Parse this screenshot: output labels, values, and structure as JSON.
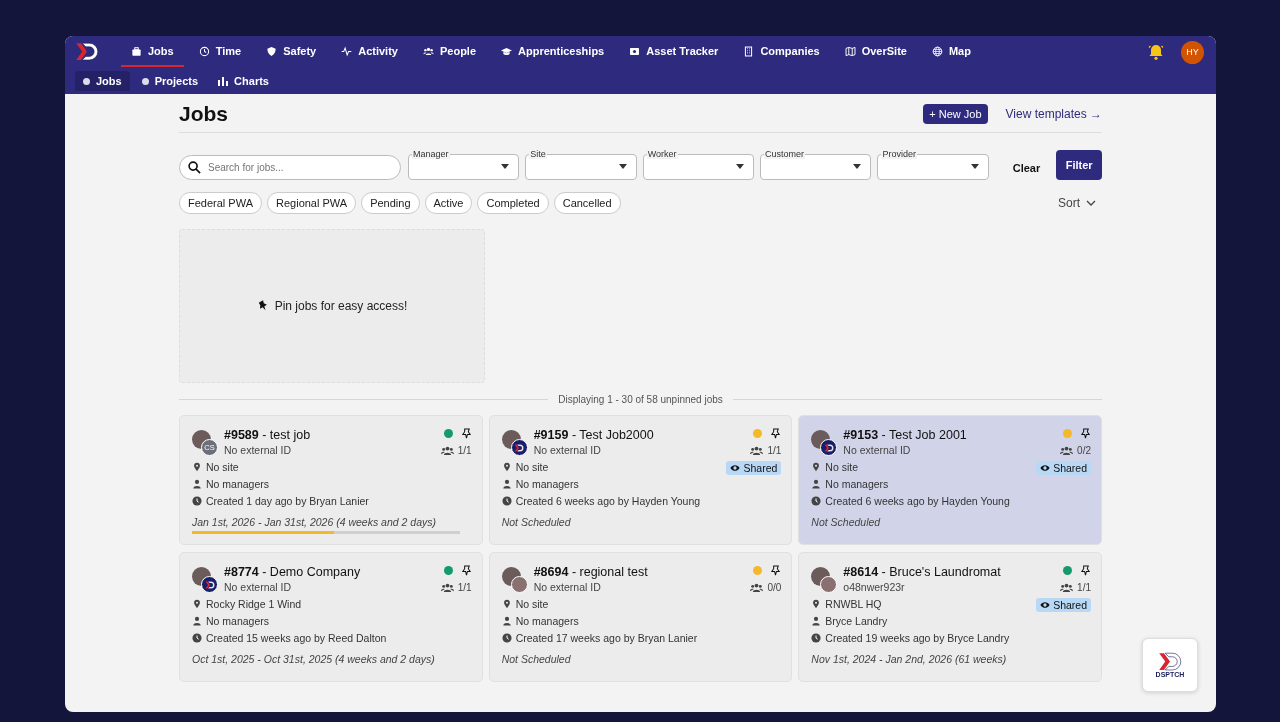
{
  "nav": {
    "items": [
      {
        "label": "Jobs",
        "selected": true
      },
      {
        "label": "Time",
        "selected": false
      },
      {
        "label": "Safety",
        "selected": false
      },
      {
        "label": "Activity",
        "selected": false
      },
      {
        "label": "People",
        "selected": false
      },
      {
        "label": "Apprenticeships",
        "selected": false
      },
      {
        "label": "Asset Tracker",
        "selected": false
      },
      {
        "label": "Companies",
        "selected": false
      },
      {
        "label": "OverSite",
        "selected": false
      },
      {
        "label": "Map",
        "selected": false
      }
    ],
    "user_initials": "HY"
  },
  "subnav": [
    {
      "label": "Jobs",
      "kind": "dot",
      "selected": true
    },
    {
      "label": "Projects",
      "kind": "dot",
      "selected": false
    },
    {
      "label": "Charts",
      "kind": "chart",
      "selected": false
    }
  ],
  "header": {
    "title": "Jobs",
    "new_job": "+ New Job",
    "view_templates": "View templates →"
  },
  "search": {
    "placeholder": "Search for jobs..."
  },
  "filters": [
    {
      "label": "Manager"
    },
    {
      "label": "Site"
    },
    {
      "label": "Worker"
    },
    {
      "label": "Customer"
    },
    {
      "label": "Provider"
    }
  ],
  "clear": "Clear",
  "filter": "Filter",
  "chips": [
    "Federal PWA",
    "Regional PWA",
    "Pending",
    "Active",
    "Completed",
    "Cancelled"
  ],
  "sort": "Sort",
  "pin_area": "Pin jobs for easy access!",
  "summary": "Displaying 1 - 30 of 58 unpinned jobs",
  "jobs": [
    {
      "title": "**#9589** - test job",
      "external_id": "No external ID",
      "kind": "initials",
      "avatar_initials": "CS",
      "color": "#159a6c",
      "workers": "1/1",
      "shared": false,
      "site": "No site",
      "managers": "No managers",
      "created": "Created 1 day ago by Bryan Lanier",
      "schedule": "Jan 1st, 2026 - Jan 31st, 2026 (4 weeks and 2 days)",
      "level": 0.53,
      "selected": false
    },
    {
      "title": "**#9159** - Test Job2000",
      "external_id": "No external ID",
      "kind": "logo",
      "color": "#f5b82a",
      "workers": "1/1",
      "shared": true,
      "shared_label": "Shared",
      "site": "No site",
      "managers": "No managers",
      "created": "Created 6 weeks ago by Hayden Young",
      "schedule": "Not Scheduled",
      "selected": false
    },
    {
      "title": "**#9153** - Test Job 2001",
      "external_id": "No external ID",
      "kind": "logo",
      "color": "#f5b82a",
      "workers": "0/2",
      "shared": true,
      "shared_label": "Shared",
      "site": "No site",
      "managers": "No managers",
      "created": "Created 6 weeks ago by Hayden Young",
      "schedule": "Not Scheduled",
      "selected": true
    },
    {
      "title": "**#8774** - Demo Company",
      "external_id": "No external ID",
      "kind": "logo",
      "color": "#159a6c",
      "workers": "1/1",
      "shared": false,
      "site": "Rocky Ridge 1 Wind",
      "managers": "No managers",
      "created": "Created 15 weeks ago by Reed Dalton",
      "schedule": "Oct 1st, 2025 - Oct 31st, 2025 (4 weeks and 2 days)",
      "selected": false
    },
    {
      "title": "**#8694** - regional test",
      "external_id": "No external ID",
      "kind": "photo",
      "color": "#f5b82a",
      "workers": "0/0",
      "shared": false,
      "site": "No site",
      "managers": "No managers",
      "created": "Created 17 weeks ago by Bryan Lanier",
      "schedule": "Not Scheduled",
      "selected": false
    },
    {
      "title": "**#8614** - Bruce's Laundromat",
      "external_id": "o48nwer923r",
      "kind": "photo",
      "color": "#159a6c",
      "workers": "1/1",
      "shared": true,
      "shared_label": "Shared",
      "site": "RNWBL HQ",
      "managers": "Bryce Landry",
      "created": "Created 19 weeks ago by Bryce Landry",
      "schedule": "Nov 1st, 2024 - Jan 2nd, 2026 (61 weeks)",
      "selected": false
    }
  ],
  "fab": {
    "label": "DSPTCH"
  }
}
